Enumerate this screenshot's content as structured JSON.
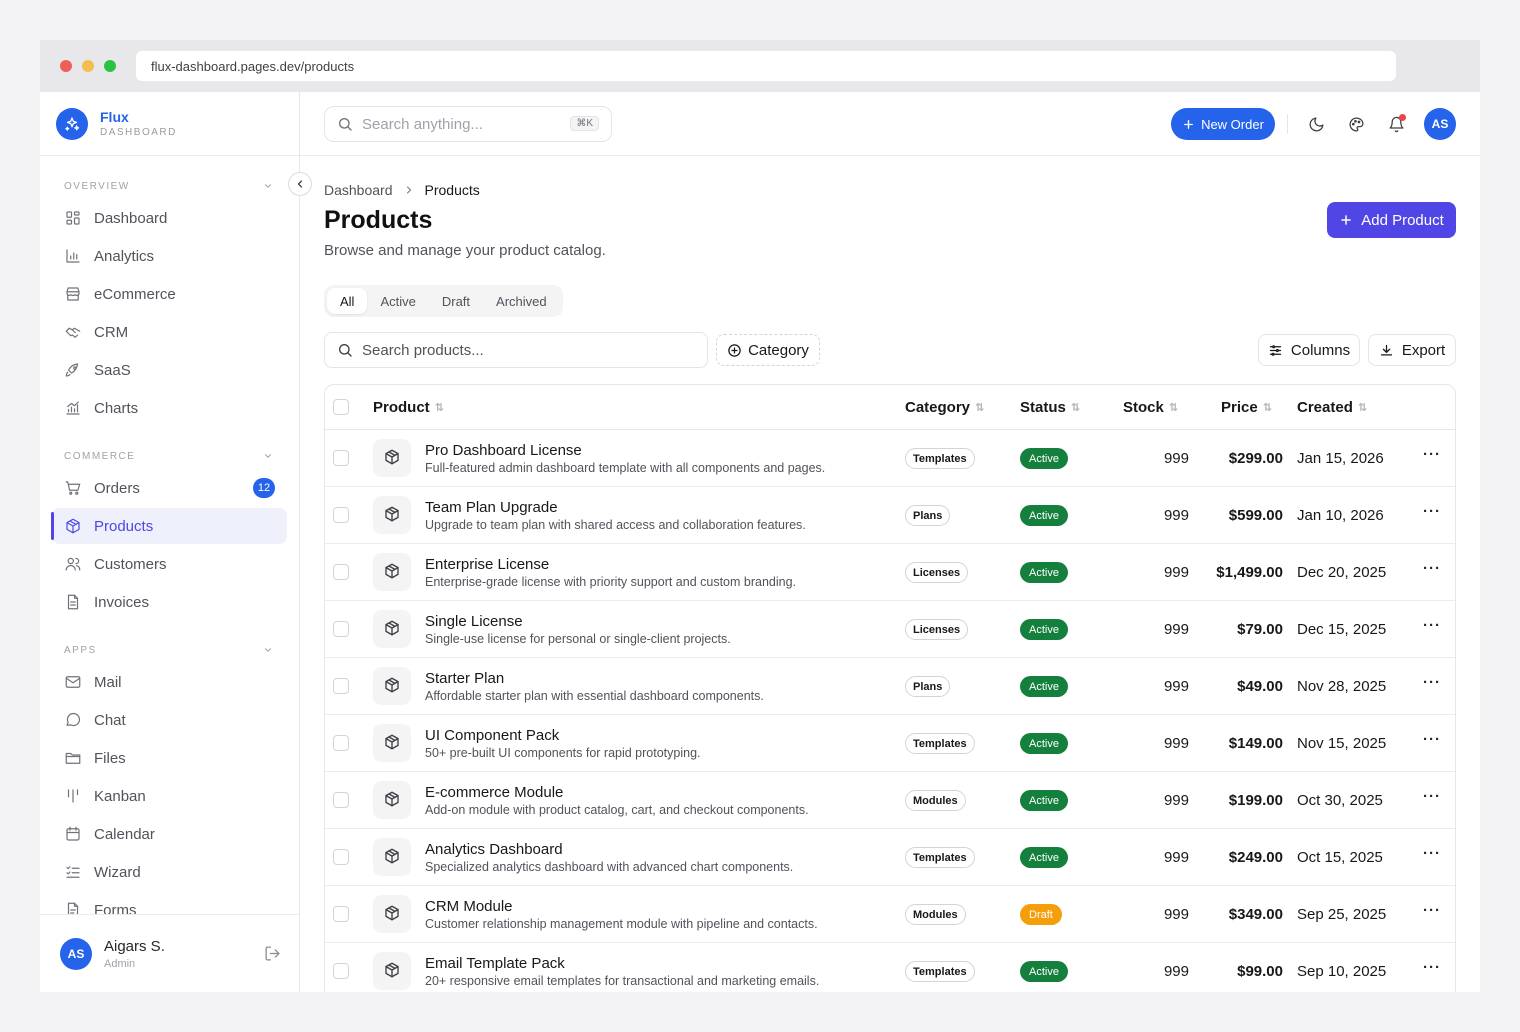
{
  "browser": {
    "url": "flux-dashboard.pages.dev/products",
    "dots": [
      "#ee5f57",
      "#f5bd4f",
      "#29c341"
    ]
  },
  "brand": {
    "name": "Flux",
    "sub": "DASHBOARD",
    "color": "#2563eb"
  },
  "sidebar": {
    "sections": [
      {
        "title": "OVERVIEW",
        "items": [
          {
            "label": "Dashboard",
            "icon": "grid-icon"
          },
          {
            "label": "Analytics",
            "icon": "bar-chart-icon"
          },
          {
            "label": "eCommerce",
            "icon": "store-icon"
          },
          {
            "label": "CRM",
            "icon": "handshake-icon"
          },
          {
            "label": "SaaS",
            "icon": "rocket-icon"
          },
          {
            "label": "Charts",
            "icon": "chart-icon"
          }
        ]
      },
      {
        "title": "COMMERCE",
        "items": [
          {
            "label": "Orders",
            "icon": "cart-icon",
            "badge": "12"
          },
          {
            "label": "Products",
            "icon": "package-icon",
            "active": true
          },
          {
            "label": "Customers",
            "icon": "users-icon"
          },
          {
            "label": "Invoices",
            "icon": "file-icon"
          }
        ]
      },
      {
        "title": "APPS",
        "items": [
          {
            "label": "Mail",
            "icon": "mail-icon"
          },
          {
            "label": "Chat",
            "icon": "chat-icon"
          },
          {
            "label": "Files",
            "icon": "folder-icon"
          },
          {
            "label": "Kanban",
            "icon": "kanban-icon"
          },
          {
            "label": "Calendar",
            "icon": "calendar-icon"
          },
          {
            "label": "Wizard",
            "icon": "list-check-icon"
          },
          {
            "label": "Forms",
            "icon": "form-icon"
          }
        ]
      }
    ]
  },
  "user": {
    "initials": "AS",
    "name": "Aigars S.",
    "role": "Admin"
  },
  "topbar": {
    "search_placeholder": "Search anything...",
    "shortcut": "⌘K",
    "new_order": "New Order",
    "avatar": "AS"
  },
  "page": {
    "breadcrumb": [
      "Dashboard",
      "Products"
    ],
    "title": "Products",
    "subtitle": "Browse and manage your product catalog.",
    "add_button": "Add Product"
  },
  "tabs": [
    "All",
    "Active",
    "Draft",
    "Archived"
  ],
  "active_tab": "All",
  "filters": {
    "search_placeholder": "Search products...",
    "category": "Category",
    "columns": "Columns",
    "export": "Export"
  },
  "table": {
    "headers": [
      "Product",
      "Category",
      "Status",
      "Stock",
      "Price",
      "Created"
    ],
    "status_colors": {
      "Active": "#15803d",
      "Draft": "#f59e0b"
    },
    "rows": [
      {
        "name": "Pro Dashboard License",
        "desc": "Full-featured admin dashboard template with all components and pages.",
        "category": "Templates",
        "status": "Active",
        "stock": "999",
        "price": "$299.00",
        "created": "Jan 15, 2026"
      },
      {
        "name": "Team Plan Upgrade",
        "desc": "Upgrade to team plan with shared access and collaboration features.",
        "category": "Plans",
        "status": "Active",
        "stock": "999",
        "price": "$599.00",
        "created": "Jan 10, 2026"
      },
      {
        "name": "Enterprise License",
        "desc": "Enterprise-grade license with priority support and custom branding.",
        "category": "Licenses",
        "status": "Active",
        "stock": "999",
        "price": "$1,499.00",
        "created": "Dec 20, 2025"
      },
      {
        "name": "Single License",
        "desc": "Single-use license for personal or single-client projects.",
        "category": "Licenses",
        "status": "Active",
        "stock": "999",
        "price": "$79.00",
        "created": "Dec 15, 2025"
      },
      {
        "name": "Starter Plan",
        "desc": "Affordable starter plan with essential dashboard components.",
        "category": "Plans",
        "status": "Active",
        "stock": "999",
        "price": "$49.00",
        "created": "Nov 28, 2025"
      },
      {
        "name": "UI Component Pack",
        "desc": "50+ pre-built UI components for rapid prototyping.",
        "category": "Templates",
        "status": "Active",
        "stock": "999",
        "price": "$149.00",
        "created": "Nov 15, 2025"
      },
      {
        "name": "E-commerce Module",
        "desc": "Add-on module with product catalog, cart, and checkout components.",
        "category": "Modules",
        "status": "Active",
        "stock": "999",
        "price": "$199.00",
        "created": "Oct 30, 2025"
      },
      {
        "name": "Analytics Dashboard",
        "desc": "Specialized analytics dashboard with advanced chart components.",
        "category": "Templates",
        "status": "Active",
        "stock": "999",
        "price": "$249.00",
        "created": "Oct 15, 2025"
      },
      {
        "name": "CRM Module",
        "desc": "Customer relationship management module with pipeline and contacts.",
        "category": "Modules",
        "status": "Draft",
        "stock": "999",
        "price": "$349.00",
        "created": "Sep 25, 2025"
      },
      {
        "name": "Email Template Pack",
        "desc": "20+ responsive email templates for transactional and marketing emails.",
        "category": "Templates",
        "status": "Active",
        "stock": "999",
        "price": "$99.00",
        "created": "Sep 10, 2025"
      }
    ]
  }
}
